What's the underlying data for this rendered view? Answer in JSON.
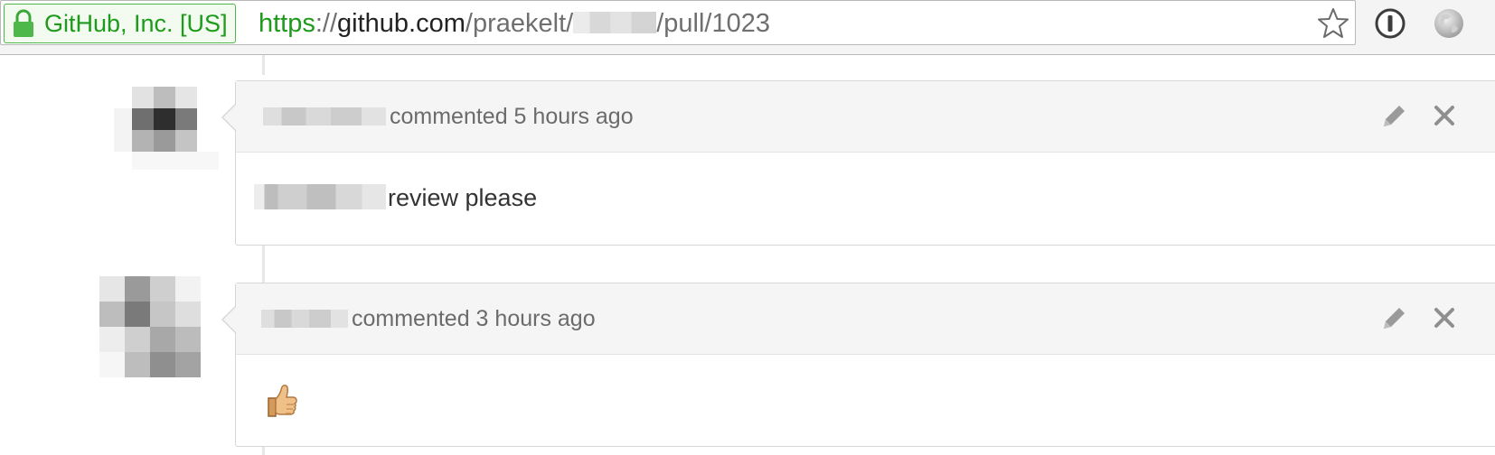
{
  "browser": {
    "ev_label": "GitHub, Inc. [US]",
    "url_scheme": "https",
    "url_sep": "://",
    "url_host": "github.com",
    "url_path_a": "/praekelt/",
    "url_path_b": "/pull/1023",
    "icons": [
      "lock-icon",
      "star-icon",
      "onepassword-icon",
      "globe-icon"
    ]
  },
  "comments": [
    {
      "meta": "commented 5 hours ago",
      "body": "review please",
      "icons": [
        "pencil-icon",
        "close-icon"
      ]
    },
    {
      "meta": "commented 3 hours ago",
      "body_icon": "thumbs-up-icon",
      "icons": [
        "pencil-icon",
        "close-icon"
      ]
    }
  ],
  "colors": {
    "ev_green": "#1e9a1c",
    "meta_text": "#6b6b6b",
    "header_bg": "#f5f5f5"
  }
}
